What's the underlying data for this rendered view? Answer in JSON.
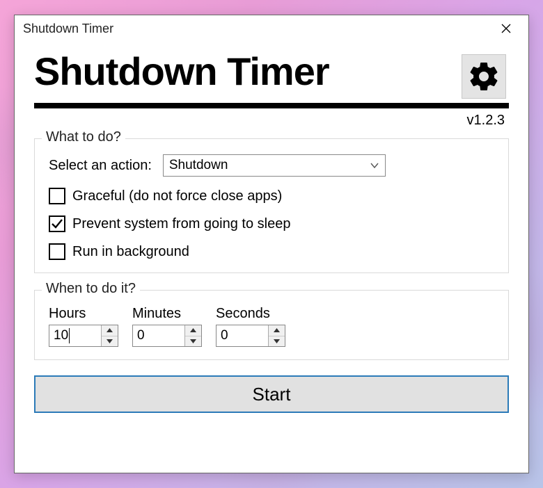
{
  "window": {
    "title": "Shutdown Timer"
  },
  "header": {
    "app_title": "Shutdown Timer",
    "version": "v1.2.3"
  },
  "action_group": {
    "legend": "What to do?",
    "select_label": "Select an action:",
    "selected_value": "Shutdown",
    "checkboxes": {
      "graceful": {
        "label": "Graceful (do not force close apps)",
        "checked": false
      },
      "prevent_sleep": {
        "label": "Prevent system from going to sleep",
        "checked": true
      },
      "background": {
        "label": "Run in background",
        "checked": false
      }
    }
  },
  "time_group": {
    "legend": "When to do it?",
    "hours_label": "Hours",
    "minutes_label": "Minutes",
    "seconds_label": "Seconds",
    "hours_value": "10",
    "minutes_value": "0",
    "seconds_value": "0"
  },
  "start": {
    "label": "Start"
  }
}
